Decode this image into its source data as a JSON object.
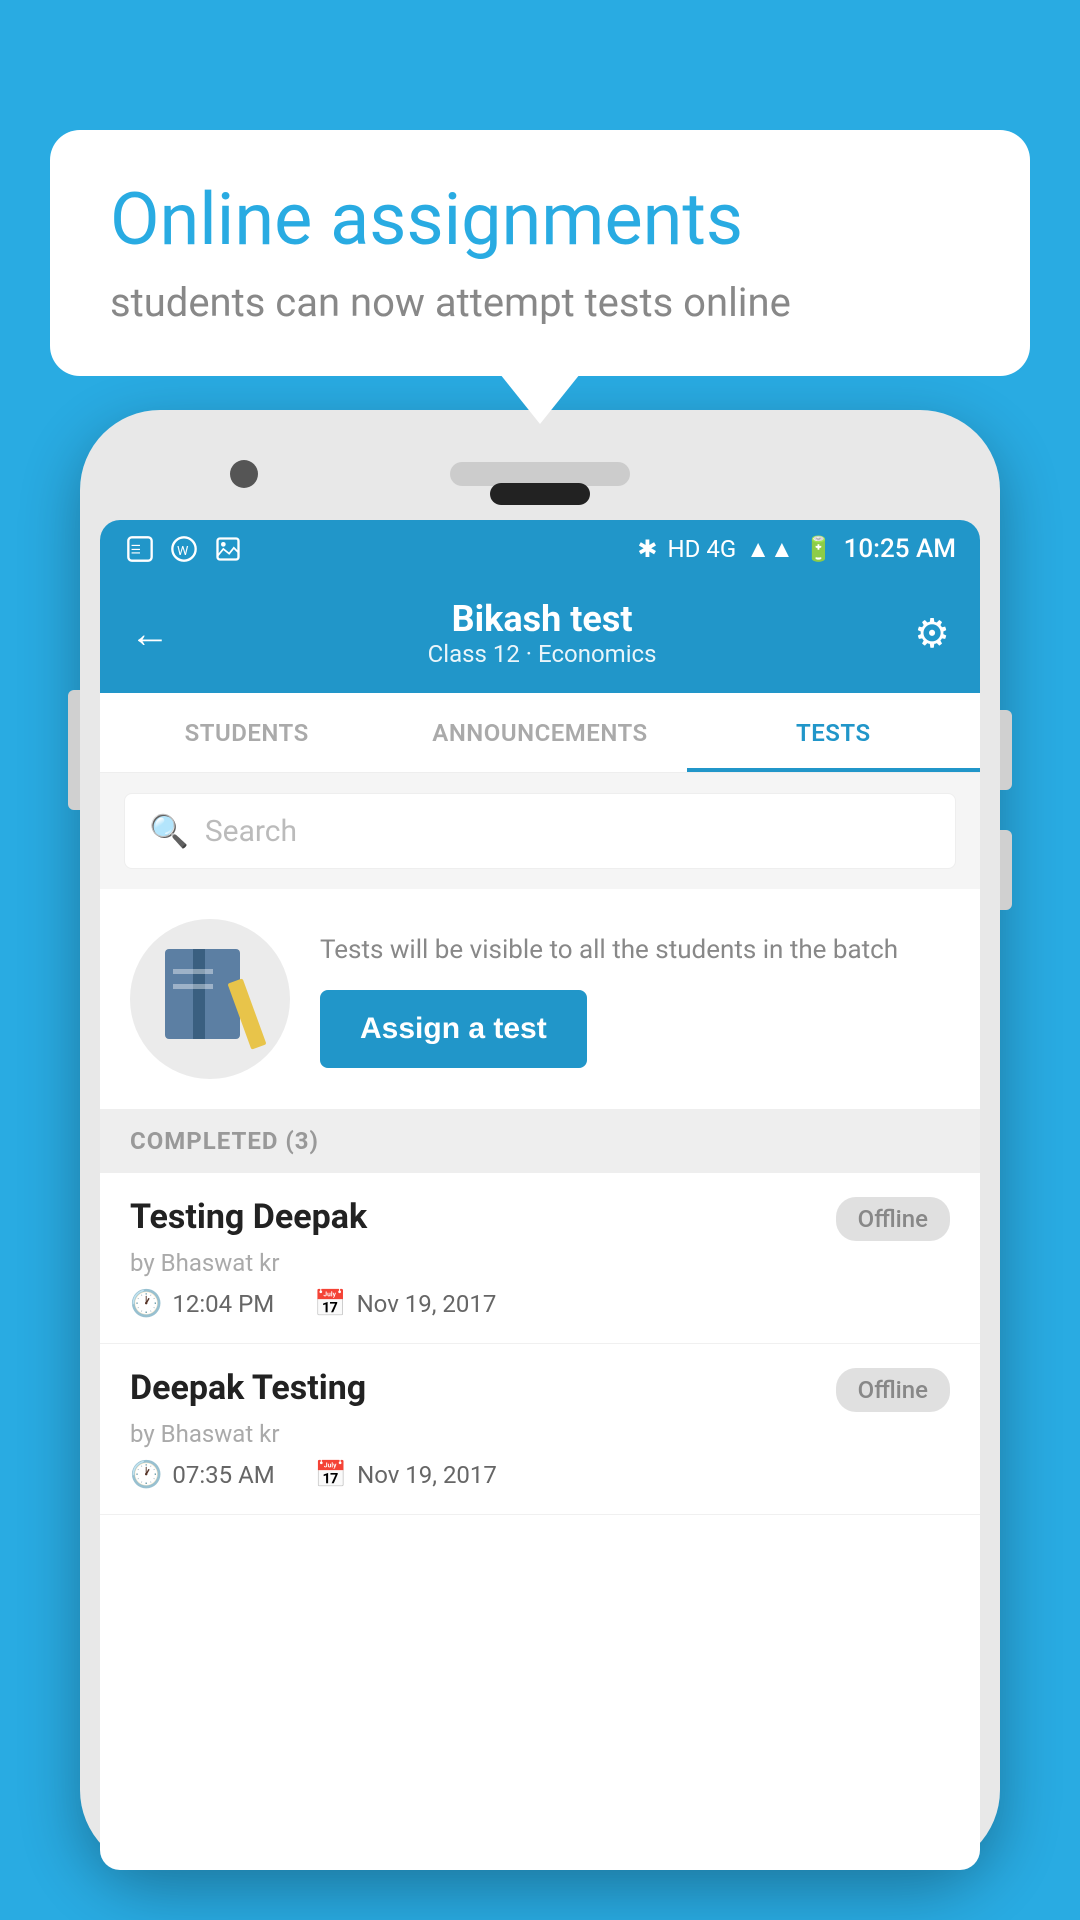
{
  "bubble": {
    "title": "Online assignments",
    "subtitle": "students can now attempt tests online"
  },
  "statusBar": {
    "time": "10:25 AM",
    "signal": "HD 4G"
  },
  "appBar": {
    "title": "Bikash test",
    "subtitle": "Class 12 · Economics",
    "backLabel": "←",
    "settingsLabel": "⚙"
  },
  "tabs": [
    {
      "label": "STUDENTS",
      "active": false
    },
    {
      "label": "ANNOUNCEMENTS",
      "active": false
    },
    {
      "label": "TESTS",
      "active": true
    }
  ],
  "search": {
    "placeholder": "Search"
  },
  "assignSection": {
    "infoText": "Tests will be visible to all the students in the batch",
    "buttonLabel": "Assign a test"
  },
  "completedSection": {
    "header": "COMPLETED (3)",
    "items": [
      {
        "name": "Testing Deepak",
        "by": "by Bhaswat kr",
        "time": "12:04 PM",
        "date": "Nov 19, 2017",
        "badge": "Offline"
      },
      {
        "name": "Deepak Testing",
        "by": "by Bhaswat kr",
        "time": "07:35 AM",
        "date": "Nov 19, 2017",
        "badge": "Offline"
      }
    ]
  }
}
